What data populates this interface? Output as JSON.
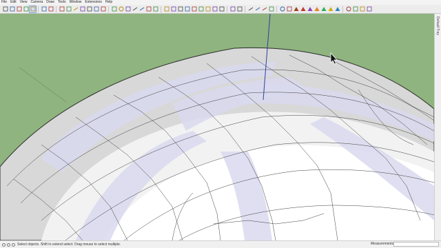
{
  "menu": [
    "File",
    "Edit",
    "View",
    "Camera",
    "Draw",
    "Tools",
    "Window",
    "Extensions",
    "Help"
  ],
  "toolbar": {
    "groups": [
      [
        "select-icon",
        "lasso-icon",
        "eraser-icon",
        "paint-bucket-icon",
        "pointer-icon"
      ],
      [
        "pushpull-icon",
        "move-icon"
      ],
      [
        "component-icon",
        "group-icon",
        "outliner-icon",
        "layer-icon",
        "scenes-icon",
        "section-icon",
        "axes-icon"
      ],
      [
        "rectangle-icon",
        "circle-icon",
        "polygon-icon",
        "arc-icon",
        "line-icon",
        "freehand-icon",
        "offset-icon"
      ],
      [
        "camera-icon",
        "house-icon",
        "car-icon",
        "model-info-icon",
        "tape-measure-icon",
        "protractor-icon",
        "text-icon",
        "dimension-icon",
        "3d-text-icon"
      ],
      [
        "grid-icon",
        "component-browser-icon"
      ],
      [
        "line-tool-icon",
        "arc-tool-icon",
        "pencil-icon",
        "follow-me-icon"
      ],
      [
        "geo-location-icon",
        "add-location-icon",
        "terrain-icon",
        "terrain-red-icon",
        "terrain-purple-icon",
        "terrain-orange-icon",
        "terrain-green-icon",
        "terrain-yellow-icon",
        "terrain-blue-icon"
      ],
      [
        "settings-icon",
        "extension-icon",
        "export-icon",
        "share-icon"
      ]
    ]
  },
  "tray": {
    "label": "Default Tray"
  },
  "status": {
    "message": "Select objects. Shift to extend select. Drag mouse to select multiple.",
    "measurements_label": "Measurements",
    "measurements_value": ""
  },
  "colors": {
    "sky": "#8fb47f",
    "surface_light": "#ffffff",
    "surface_shadow": "#d2d2d2",
    "band": "#d9d9ee",
    "edge": "#3a3a3a",
    "axis_blue": "#2d3f9b"
  }
}
